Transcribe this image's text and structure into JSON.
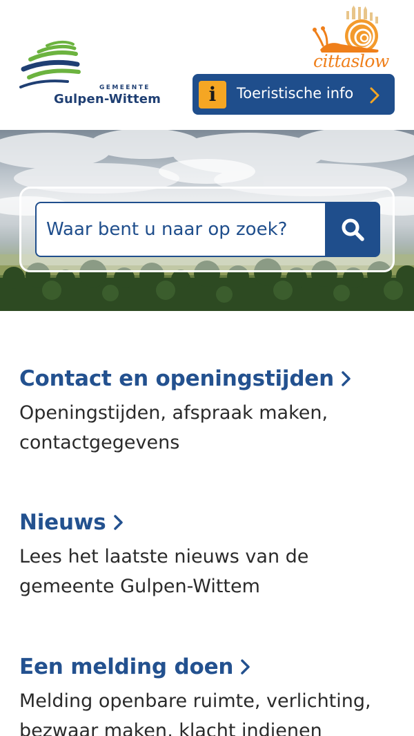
{
  "header": {
    "logo": {
      "top_text": "GEMEENTE",
      "name": "Gulpen-Wittem",
      "icon": "gulpen-wittem-logo-icon"
    },
    "cittaslow": {
      "text": "cittaslow",
      "icon": "snail-icon"
    },
    "tourist_button": {
      "label": "Toeristische info",
      "icon": "info-icon",
      "icon_glyph": "i",
      "chevron_icon": "chevron-right-icon"
    }
  },
  "hero": {
    "search": {
      "placeholder": "Waar bent u naar op zoek?",
      "value": "",
      "button_icon": "search-icon"
    }
  },
  "items": [
    {
      "title": "Contact en openingstijden",
      "description": "Openingstijden, afspraak maken, contactgegevens",
      "chevron_icon": "chevron-right-icon"
    },
    {
      "title": "Nieuws",
      "description": "Lees het laatste nieuws van de gemeente Gulpen-Wittem",
      "chevron_icon": "chevron-right-icon"
    },
    {
      "title": "Een melding doen",
      "description": "Melding openbare ruimte, verlichting, bezwaar maken, klacht indienen",
      "chevron_icon": "chevron-right-icon"
    }
  ],
  "colors": {
    "primary_blue": "#1f4e8c",
    "link_blue": "#23518f",
    "accent_orange": "#f5a623",
    "cittaslow_orange": "#ef7f1a",
    "logo_green": "#6cb33f",
    "text_dark": "#2a2a2a"
  }
}
